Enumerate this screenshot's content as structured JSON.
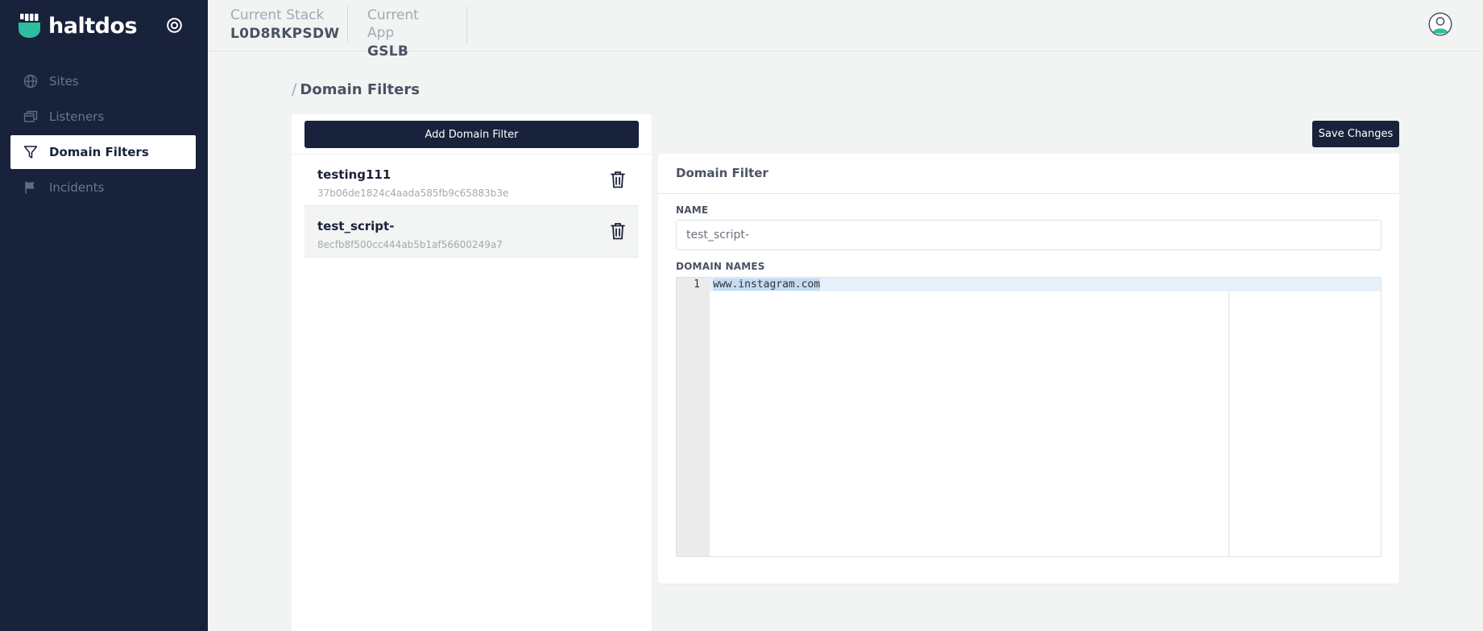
{
  "brand": {
    "name": "haltdos"
  },
  "sidebar": {
    "items": [
      {
        "label": "Sites",
        "icon": "globe-icon",
        "active": false
      },
      {
        "label": "Listeners",
        "icon": "windows-icon",
        "active": false
      },
      {
        "label": "Domain Filters",
        "icon": "filter-icon",
        "active": true
      },
      {
        "label": "Incidents",
        "icon": "flag-icon",
        "active": false
      }
    ]
  },
  "header": {
    "stack_label": "Current Stack",
    "stack_value": "L0D8RKPSDW",
    "app_label": "Current App",
    "app_value": "GSLB"
  },
  "breadcrumb": {
    "separator": "/",
    "title": "Domain Filters"
  },
  "list": {
    "add_label": "Add Domain Filter",
    "items": [
      {
        "name": "testing111",
        "id": "37b06de1824c4aada585fb9c65883b3e",
        "selected": false
      },
      {
        "name": "test_script-",
        "id": "8ecfb8f500cc444ab5b1af56600249a7",
        "selected": true
      }
    ]
  },
  "toolbar": {
    "save_label": "Save Changes"
  },
  "detail": {
    "title": "Domain Filter",
    "name_label": "NAME",
    "name_value": "test_script-",
    "domains_label": "DOMAIN NAMES",
    "editor": {
      "line_number": "1",
      "line_text": "www.instagram.com"
    }
  },
  "colors": {
    "sidebar_bg": "#18223b",
    "brand_accent": "#2bbfa0",
    "button_bg": "#18223b",
    "page_bg": "#f2f4f3"
  }
}
